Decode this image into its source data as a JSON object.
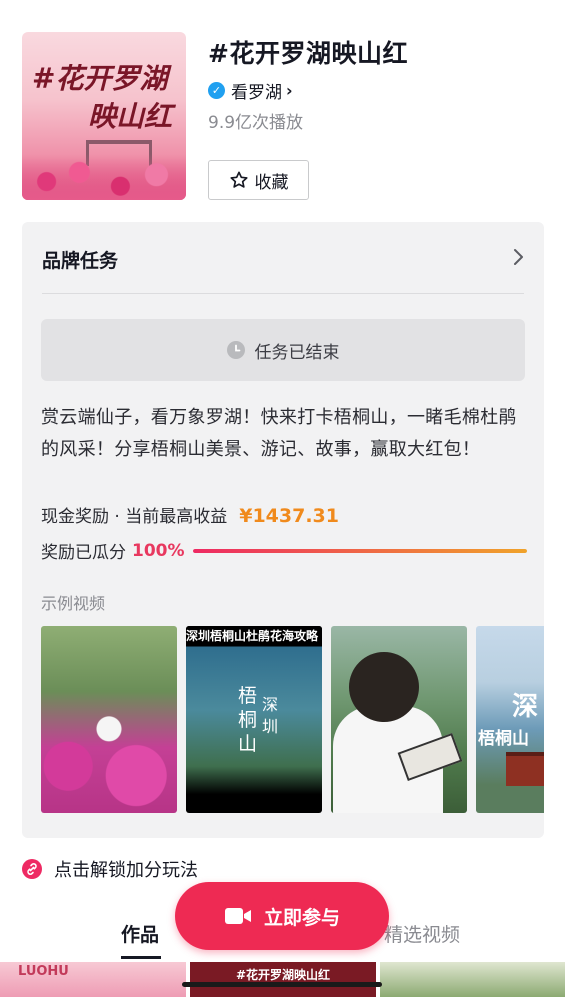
{
  "topic": {
    "title": "#花开罗湖映山红",
    "account_name": "看罗湖",
    "plays": "9.9亿次播放",
    "favorite_label": "收藏",
    "cover_text_line1": "#花开罗湖",
    "cover_text_line2": "映山红"
  },
  "task": {
    "heading": "品牌任务",
    "status": "任务已结束",
    "description": "赏云端仙子，看万象罗湖！快来打卡梧桐山，一睹毛棉杜鹃的风采！分享梧桐山美景、游记、故事，赢取大红包！",
    "reward_label": "现金奖励 · 当前最高收益",
    "reward_amount": "¥1437.31",
    "progress_label": "奖励已瓜分",
    "progress_pct_text": "100%",
    "progress_fraction": 1.0,
    "examples_label": "示例视频",
    "examples": [
      {
        "overlay": ""
      },
      {
        "banner": "深圳梧桐山杜鹃花海攻略",
        "text1": "梧桐山",
        "text2": "深圳"
      },
      {
        "overlay": ""
      },
      {
        "text1": "深",
        "text2": "梧桐山"
      }
    ]
  },
  "bonus": {
    "label": "点击解锁加分玩法"
  },
  "tabs": {
    "works": "作品",
    "featured": "精选视频"
  },
  "join_button": "立即参与",
  "bottom_strip": {
    "logo": "LUOHU",
    "banner": "#花开罗湖映山红"
  },
  "colors": {
    "accent": "#ee2a53",
    "reward": "#f08a1c",
    "verified": "#20a0f0"
  }
}
